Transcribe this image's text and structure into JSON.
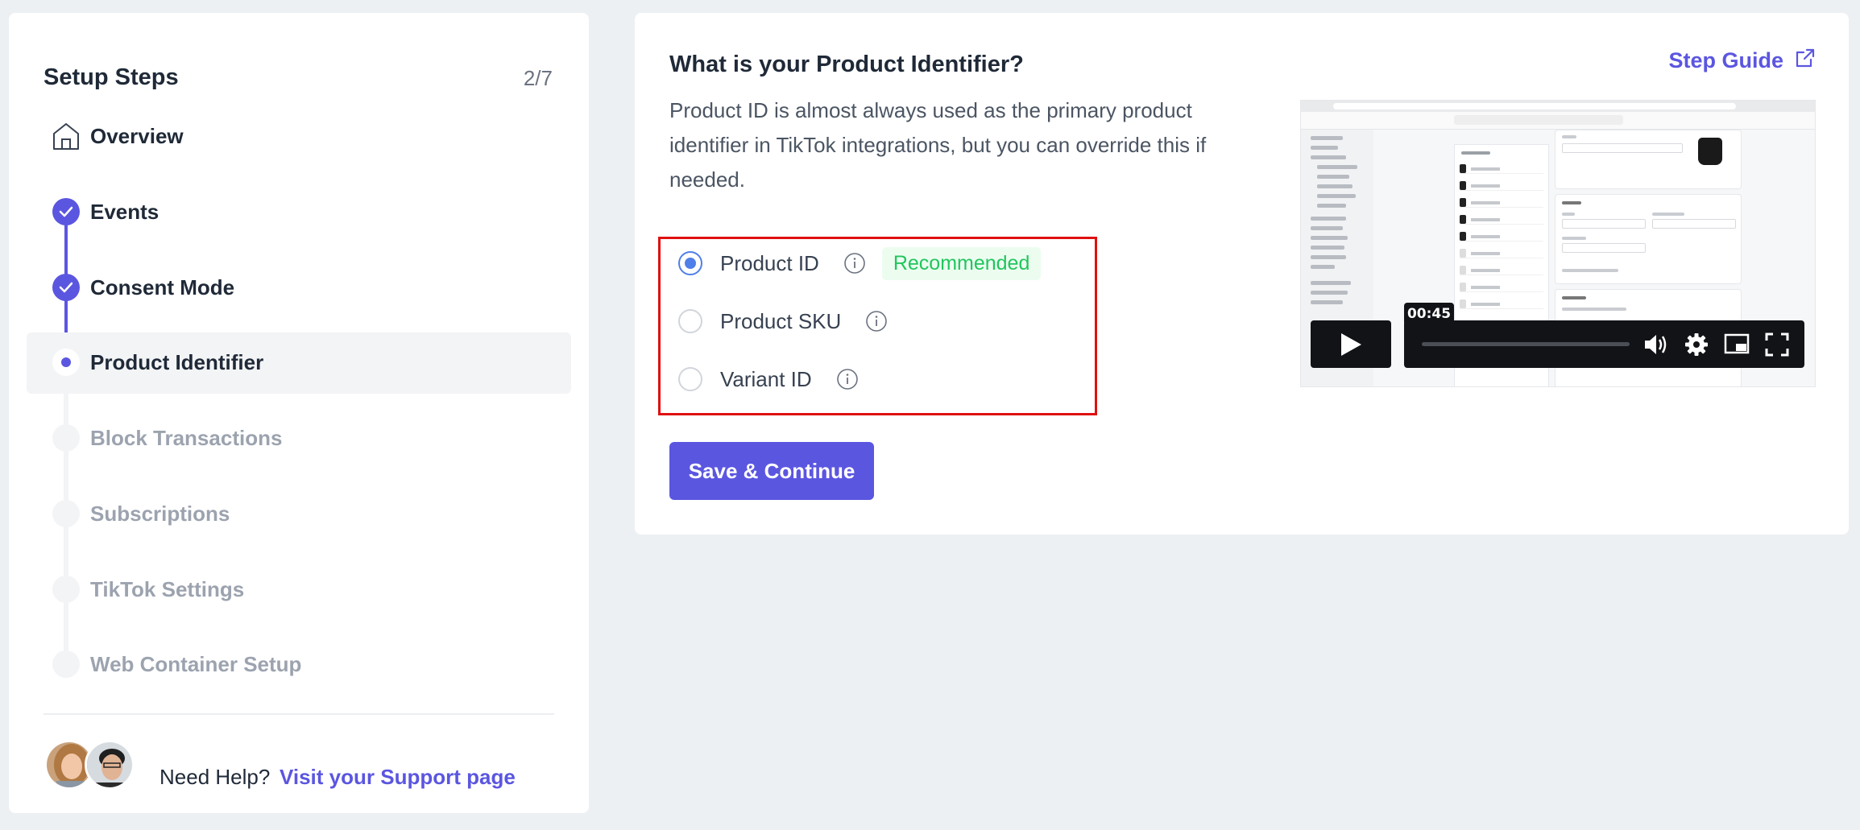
{
  "sidebar": {
    "title": "Setup Steps",
    "progress": "2/7",
    "steps": [
      {
        "label": "Overview",
        "state": "home"
      },
      {
        "label": "Events",
        "state": "done"
      },
      {
        "label": "Consent Mode",
        "state": "done"
      },
      {
        "label": "Product Identifier",
        "state": "current"
      },
      {
        "label": "Block Transactions",
        "state": "pending"
      },
      {
        "label": "Subscriptions",
        "state": "pending"
      },
      {
        "label": "TikTok Settings",
        "state": "pending"
      },
      {
        "label": "Web Container Setup",
        "state": "pending"
      }
    ],
    "help": {
      "text": "Need Help?",
      "link": "Visit your Support page"
    }
  },
  "main": {
    "title": "What is your Product Identifier?",
    "step_guide": "Step Guide",
    "description": "Product ID is almost always used as the primary product identifier in TikTok integrations, but you can override this if needed.",
    "options": [
      {
        "label": "Product ID",
        "selected": true,
        "badge": "Recommended"
      },
      {
        "label": "Product SKU",
        "selected": false
      },
      {
        "label": "Variant ID",
        "selected": false
      }
    ],
    "save_label": "Save & Continue",
    "video": {
      "time": "00:45"
    }
  },
  "colors": {
    "accent": "#5b56e0",
    "radio_selected": "#4f7fe8",
    "badge_text": "#22c55e",
    "highlight_border": "#e01010"
  }
}
